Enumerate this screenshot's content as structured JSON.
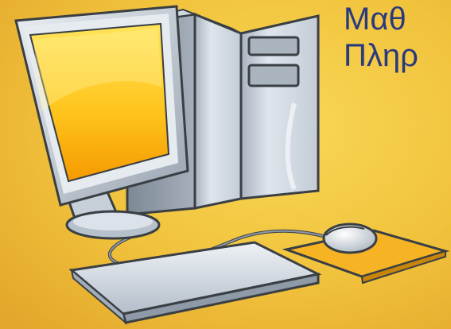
{
  "slide": {
    "title_line_1": "Μαθ",
    "title_line_2": "Πληρ",
    "colors": {
      "background_light": "#f6d04a",
      "background_dark": "#e3a92a",
      "title_text": "#2a3a7e",
      "screen_yellow": "#ffd21a",
      "screen_orange": "#f59a00",
      "tower_light": "#dde4ec",
      "tower_dark": "#8f9aa8",
      "outline": "#3a3f44",
      "mousepad": "#f3a91b"
    },
    "illustration": {
      "name": "desktop-computer-clipart",
      "parts": [
        "monitor",
        "tower",
        "keyboard",
        "mouse",
        "mousepad",
        "cable"
      ]
    }
  }
}
